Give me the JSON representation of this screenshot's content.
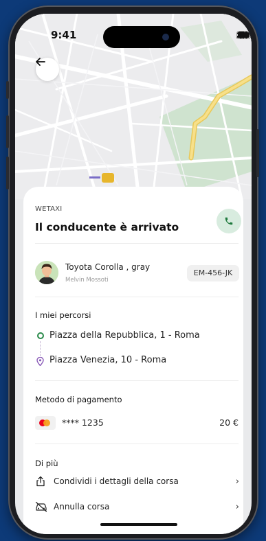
{
  "status_bar": {
    "time": "9:41"
  },
  "map": {
    "route_color": "#f2d77a",
    "park_color": "#cfe3cf"
  },
  "sheet": {
    "brand": "WETAXI",
    "title": "Il conducente è arrivato",
    "call_icon": "phone-icon"
  },
  "driver": {
    "car": "Toyota Corolla , gray",
    "name": "Melvin Mossoti",
    "plate": "EM-456-JK"
  },
  "routes": {
    "heading": "I miei percorsi",
    "from": "Piazza della Repubblica, 1 - Roma",
    "to": "Piazza Venezia, 10 - Roma"
  },
  "payment": {
    "heading": "Metodo di pagamento",
    "card": "**** 1235",
    "amount": "20 €"
  },
  "more": {
    "heading": "Di più",
    "items": [
      {
        "label": "Condividi i dettagli della corsa",
        "icon": "share-icon"
      },
      {
        "label": "Annulla corsa",
        "icon": "cancel-car-icon"
      }
    ]
  },
  "colors": {
    "accent_green": "#2a8a4a",
    "background": "#0d3a78"
  }
}
